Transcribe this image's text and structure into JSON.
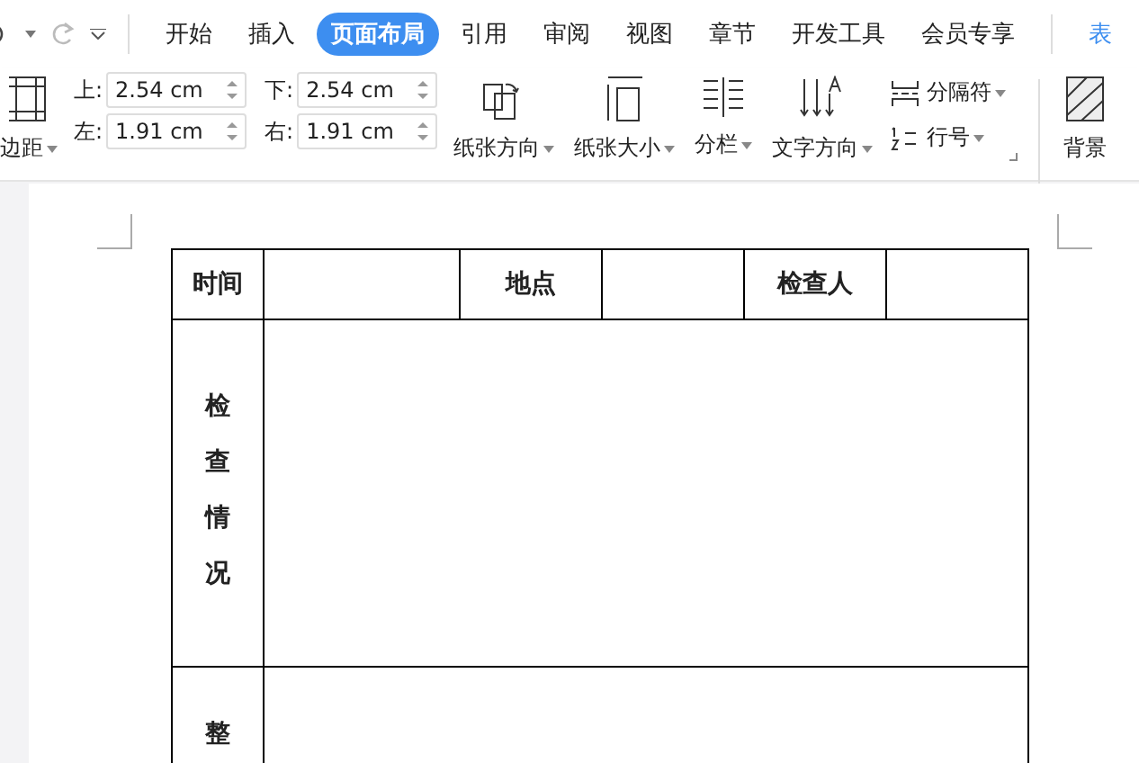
{
  "tabs": [
    {
      "label": "开始",
      "selected": false
    },
    {
      "label": "插入",
      "selected": false
    },
    {
      "label": "页面布局",
      "selected": true
    },
    {
      "label": "引用",
      "selected": false
    },
    {
      "label": "审阅",
      "selected": false
    },
    {
      "label": "视图",
      "selected": false
    },
    {
      "label": "章节",
      "selected": false
    },
    {
      "label": "开发工具",
      "selected": false
    },
    {
      "label": "会员专享",
      "selected": false
    }
  ],
  "cut_tab": "表",
  "ribbon": {
    "margins_label": "边距",
    "margins": [
      {
        "label": "上:",
        "value": "2.54 cm"
      },
      {
        "label": "下:",
        "value": "2.54 cm"
      },
      {
        "label": "左:",
        "value": "1.91 cm"
      },
      {
        "label": "右:",
        "value": "1.91 cm"
      }
    ],
    "large_buttons": [
      {
        "label": "纸张方向",
        "kind": "orientation"
      },
      {
        "label": "纸张大小",
        "kind": "size"
      },
      {
        "label": "分栏",
        "kind": "columns"
      },
      {
        "label": "文字方向",
        "kind": "direction"
      }
    ],
    "small_buttons": [
      {
        "label": "分隔符",
        "kind": "breaks"
      },
      {
        "label": "行号",
        "kind": "lines"
      }
    ],
    "background": "背景"
  },
  "table": {
    "header_labels": [
      "时间",
      "地点",
      "检查人"
    ],
    "rows": [
      {
        "label": "检查情况"
      },
      {
        "label": "整"
      }
    ]
  }
}
